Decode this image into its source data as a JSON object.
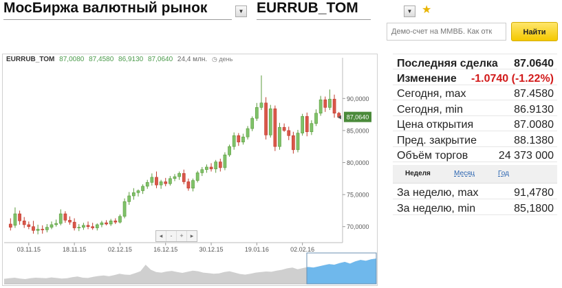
{
  "header": {
    "market_title": "МосБиржа валютный рынок",
    "instrument": "EURRUB_TOM"
  },
  "search": {
    "placeholder": "Демо-счет на ММВБ. Как отк",
    "button_label": "Найти"
  },
  "chart_header": {
    "symbol": "EURRUB_TOM",
    "open": "87,0080",
    "high": "87,4580",
    "low": "86,9130",
    "close": "87,0640",
    "volume": "24,4 млн.",
    "period": "день"
  },
  "chart_data": {
    "type": "candlestick",
    "title": "",
    "ylim": [
      67.5,
      95.5
    ],
    "yticks": [
      {
        "v": 70,
        "label": "70,0000"
      },
      {
        "v": 75,
        "label": "75,0000"
      },
      {
        "v": 80,
        "label": "80,0000"
      },
      {
        "v": 85,
        "label": "85,0000"
      },
      {
        "v": 90,
        "label": "90,0000"
      }
    ],
    "xticks": [
      {
        "i": 4,
        "label": "03.11.15"
      },
      {
        "i": 14,
        "label": "18.11.15"
      },
      {
        "i": 24,
        "label": "02.12.15"
      },
      {
        "i": 34,
        "label": "16.12.15"
      },
      {
        "i": 44,
        "label": "30.12.15"
      },
      {
        "i": 54,
        "label": "19.01.16"
      },
      {
        "i": 64,
        "label": "02.02.16"
      }
    ],
    "last_price_label": "87,0640",
    "last_price": 87.064,
    "candles": [
      {
        "o": 70.4,
        "h": 71.3,
        "l": 69.4,
        "c": 69.9
      },
      {
        "o": 70.2,
        "h": 73.0,
        "l": 69.8,
        "c": 72.0
      },
      {
        "o": 72.0,
        "h": 72.5,
        "l": 70.3,
        "c": 70.9
      },
      {
        "o": 70.9,
        "h": 71.5,
        "l": 69.8,
        "c": 70.3
      },
      {
        "o": 70.3,
        "h": 70.8,
        "l": 69.6,
        "c": 70.0
      },
      {
        "o": 70.0,
        "h": 70.9,
        "l": 68.9,
        "c": 69.4
      },
      {
        "o": 69.4,
        "h": 70.3,
        "l": 68.8,
        "c": 69.6
      },
      {
        "o": 69.6,
        "h": 70.2,
        "l": 68.9,
        "c": 69.5
      },
      {
        "o": 69.5,
        "h": 70.4,
        "l": 69.1,
        "c": 69.9
      },
      {
        "o": 69.9,
        "h": 70.8,
        "l": 69.6,
        "c": 70.3
      },
      {
        "o": 70.3,
        "h": 71.1,
        "l": 70.0,
        "c": 70.5
      },
      {
        "o": 70.5,
        "h": 72.7,
        "l": 70.2,
        "c": 72.0
      },
      {
        "o": 72.0,
        "h": 72.4,
        "l": 70.6,
        "c": 71.0
      },
      {
        "o": 71.0,
        "h": 71.6,
        "l": 70.3,
        "c": 70.7
      },
      {
        "o": 70.7,
        "h": 71.3,
        "l": 69.4,
        "c": 69.8
      },
      {
        "o": 69.8,
        "h": 70.4,
        "l": 69.3,
        "c": 69.9
      },
      {
        "o": 69.9,
        "h": 70.6,
        "l": 69.5,
        "c": 70.2
      },
      {
        "o": 70.2,
        "h": 70.8,
        "l": 69.6,
        "c": 70.0
      },
      {
        "o": 70.0,
        "h": 70.6,
        "l": 69.5,
        "c": 69.8
      },
      {
        "o": 69.8,
        "h": 70.5,
        "l": 69.4,
        "c": 70.3
      },
      {
        "o": 70.3,
        "h": 70.9,
        "l": 69.9,
        "c": 70.6
      },
      {
        "o": 70.6,
        "h": 71.0,
        "l": 70.2,
        "c": 70.4
      },
      {
        "o": 70.4,
        "h": 71.2,
        "l": 70.1,
        "c": 70.9
      },
      {
        "o": 70.9,
        "h": 71.3,
        "l": 70.4,
        "c": 70.7
      },
      {
        "o": 70.7,
        "h": 71.9,
        "l": 70.5,
        "c": 71.6
      },
      {
        "o": 71.6,
        "h": 74.4,
        "l": 71.3,
        "c": 73.9
      },
      {
        "o": 73.9,
        "h": 75.4,
        "l": 73.4,
        "c": 74.8
      },
      {
        "o": 74.8,
        "h": 76.0,
        "l": 74.2,
        "c": 75.3
      },
      {
        "o": 75.3,
        "h": 75.8,
        "l": 74.7,
        "c": 75.6
      },
      {
        "o": 75.6,
        "h": 76.6,
        "l": 75.1,
        "c": 76.3
      },
      {
        "o": 76.3,
        "h": 77.3,
        "l": 75.9,
        "c": 76.9
      },
      {
        "o": 76.9,
        "h": 78.3,
        "l": 76.4,
        "c": 77.7
      },
      {
        "o": 77.7,
        "h": 78.6,
        "l": 76.0,
        "c": 76.5
      },
      {
        "o": 76.5,
        "h": 77.3,
        "l": 75.9,
        "c": 77.0
      },
      {
        "o": 77.0,
        "h": 77.6,
        "l": 76.3,
        "c": 76.7
      },
      {
        "o": 76.7,
        "h": 77.9,
        "l": 76.4,
        "c": 77.5
      },
      {
        "o": 77.5,
        "h": 78.2,
        "l": 77.1,
        "c": 77.8
      },
      {
        "o": 77.8,
        "h": 78.6,
        "l": 77.3,
        "c": 78.3
      },
      {
        "o": 78.3,
        "h": 78.9,
        "l": 76.6,
        "c": 77.0
      },
      {
        "o": 77.0,
        "h": 77.5,
        "l": 75.6,
        "c": 76.0
      },
      {
        "o": 76.0,
        "h": 77.5,
        "l": 75.5,
        "c": 77.2
      },
      {
        "o": 77.2,
        "h": 78.7,
        "l": 76.9,
        "c": 78.4
      },
      {
        "o": 78.4,
        "h": 79.3,
        "l": 77.9,
        "c": 78.9
      },
      {
        "o": 78.9,
        "h": 79.7,
        "l": 78.4,
        "c": 79.3
      },
      {
        "o": 79.3,
        "h": 79.9,
        "l": 78.6,
        "c": 79.0
      },
      {
        "o": 79.0,
        "h": 80.4,
        "l": 78.4,
        "c": 80.1
      },
      {
        "o": 80.1,
        "h": 80.6,
        "l": 78.6,
        "c": 79.2
      },
      {
        "o": 79.2,
        "h": 81.6,
        "l": 78.8,
        "c": 81.2
      },
      {
        "o": 81.2,
        "h": 82.8,
        "l": 80.9,
        "c": 82.5
      },
      {
        "o": 82.5,
        "h": 84.7,
        "l": 82.0,
        "c": 84.2
      },
      {
        "o": 84.2,
        "h": 84.6,
        "l": 82.6,
        "c": 83.2
      },
      {
        "o": 83.2,
        "h": 84.5,
        "l": 82.8,
        "c": 84.0
      },
      {
        "o": 84.0,
        "h": 85.7,
        "l": 83.6,
        "c": 85.3
      },
      {
        "o": 85.3,
        "h": 87.2,
        "l": 84.9,
        "c": 86.9
      },
      {
        "o": 86.9,
        "h": 89.3,
        "l": 86.5,
        "c": 88.6
      },
      {
        "o": 88.6,
        "h": 93.6,
        "l": 88.2,
        "c": 89.3
      },
      {
        "o": 89.3,
        "h": 90.2,
        "l": 83.6,
        "c": 84.3
      },
      {
        "o": 84.3,
        "h": 89.0,
        "l": 83.9,
        "c": 88.4
      },
      {
        "o": 88.4,
        "h": 88.9,
        "l": 81.8,
        "c": 82.5
      },
      {
        "o": 82.5,
        "h": 86.2,
        "l": 82.0,
        "c": 85.5
      },
      {
        "o": 85.5,
        "h": 86.1,
        "l": 84.8,
        "c": 85.0
      },
      {
        "o": 85.0,
        "h": 85.6,
        "l": 83.5,
        "c": 84.2
      },
      {
        "o": 84.2,
        "h": 84.8,
        "l": 81.4,
        "c": 82.0
      },
      {
        "o": 82.0,
        "h": 85.1,
        "l": 81.6,
        "c": 84.6
      },
      {
        "o": 84.6,
        "h": 87.6,
        "l": 84.2,
        "c": 87.2
      },
      {
        "o": 87.2,
        "h": 87.8,
        "l": 84.1,
        "c": 84.8
      },
      {
        "o": 84.8,
        "h": 86.6,
        "l": 84.3,
        "c": 86.1
      },
      {
        "o": 86.1,
        "h": 88.3,
        "l": 85.7,
        "c": 87.7
      },
      {
        "o": 87.7,
        "h": 90.4,
        "l": 87.3,
        "c": 89.8
      },
      {
        "o": 89.8,
        "h": 90.3,
        "l": 87.9,
        "c": 88.6
      },
      {
        "o": 88.6,
        "h": 91.4,
        "l": 88.2,
        "c": 89.9
      },
      {
        "o": 89.9,
        "h": 90.6,
        "l": 87.0,
        "c": 87.7
      },
      {
        "o": 87.7,
        "h": 87.9,
        "l": 86.9,
        "c": 87.06
      }
    ],
    "navigator": [
      0.18,
      0.2,
      0.22,
      0.19,
      0.17,
      0.2,
      0.22,
      0.21,
      0.2,
      0.23,
      0.21,
      0.19,
      0.2,
      0.24,
      0.26,
      0.22,
      0.21,
      0.25,
      0.28,
      0.3,
      0.27,
      0.31,
      0.36,
      0.33,
      0.32,
      0.38,
      0.45,
      0.68,
      0.5,
      0.42,
      0.4,
      0.44,
      0.46,
      0.42,
      0.39,
      0.43,
      0.47,
      0.45,
      0.4,
      0.38,
      0.36,
      0.37,
      0.42,
      0.45,
      0.4,
      0.35,
      0.33,
      0.36,
      0.4,
      0.42,
      0.44,
      0.43,
      0.47,
      0.5,
      0.55,
      0.58,
      0.52,
      0.56,
      0.6,
      0.58,
      0.62,
      0.66,
      0.7,
      0.68,
      0.74,
      0.78,
      0.72,
      0.8,
      0.85,
      0.82,
      0.87,
      0.9
    ]
  },
  "nav_controls": [
    "◂",
    "‑",
    "+",
    "▸"
  ],
  "stats": [
    {
      "key": "Последняя сделка",
      "value": "87.0640",
      "bold": true,
      "neg": false
    },
    {
      "key": "Изменение",
      "value": "-1.0740 (-1.22%)",
      "bold": true,
      "neg": true
    },
    {
      "key": "Сегодня, max",
      "value": "87.4580",
      "bold": false,
      "neg": false
    },
    {
      "key": "Сегодня, min",
      "value": "86.9130",
      "bold": false,
      "neg": false
    },
    {
      "key": "Цена открытия",
      "value": "87.0080",
      "bold": false,
      "neg": false
    },
    {
      "key": "Пред. закрытие",
      "value": "88.1380",
      "bold": false,
      "neg": false
    },
    {
      "key": "Объём торгов",
      "value": "24 373 000",
      "bold": false,
      "neg": false
    }
  ],
  "period_tabs": {
    "week": "Неделя",
    "month": "Месяц",
    "year": "Год"
  },
  "period_stats": [
    {
      "key": "За неделю, max",
      "value": "91,4780"
    },
    {
      "key": "За неделю, min",
      "value": "85,1800"
    }
  ],
  "colors": {
    "up": "#5a9a3a",
    "down": "#c0392b",
    "navigator": "#cfcfcf",
    "navigator_window": "#6fb8ec"
  }
}
